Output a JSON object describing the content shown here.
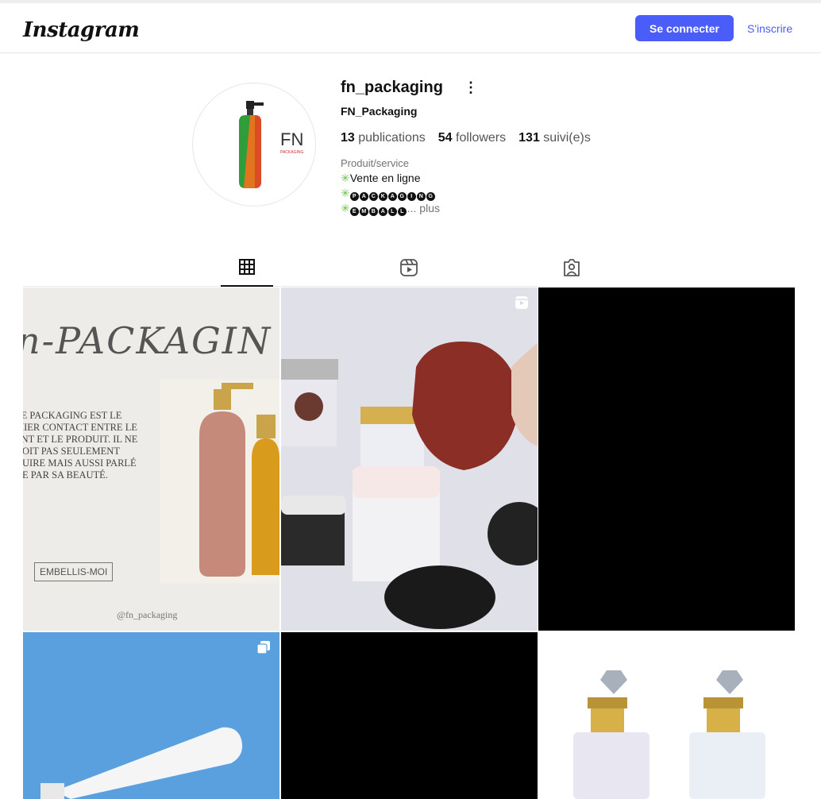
{
  "header": {
    "logo": "Instagram",
    "login_label": "Se connecter",
    "signup_label": "S'inscrire"
  },
  "profile": {
    "username": "fn_packaging",
    "more_icon": "⋮",
    "full_name": "FN_Packaging",
    "stats": [
      {
        "count": "13",
        "label": "publications"
      },
      {
        "count": "54",
        "label": "followers"
      },
      {
        "count": "131",
        "label": "suivi(e)s"
      }
    ],
    "category": "Produit/service",
    "bio_line1": "Vente en ligne",
    "bio_line2_letters": [
      "P",
      "A",
      "C",
      "K",
      "A",
      "G",
      "I",
      "N",
      "G"
    ],
    "bio_line3_letters": [
      "E",
      "M",
      "B",
      "A",
      "L",
      "L"
    ],
    "bio_more": "... plus",
    "avatar_text": "FN",
    "avatar_subtext": "PACKAGING"
  },
  "tabs": [
    {
      "name": "grid",
      "icon": "grid-icon"
    },
    {
      "name": "reels",
      "icon": "reels-icon"
    },
    {
      "name": "tagged",
      "icon": "tagged-user-icon"
    }
  ],
  "posts": {
    "p1_title": "n-PACKAGIN",
    "p1_text": "LE PACKAGING EST LE\nMIER CONTACT ENTRE LE\nENT ET LE PRODUIT. IL NE\nDOIT PAS SEULEMENT\nDUIRE MAIS AUSSI PARLÉ\nDE PAR SA BEAUTÉ.",
    "p1_tag": "EMBELLIS-MOI",
    "p1_handle": "@fn_packaging"
  },
  "colors": {
    "accent": "#4a5df9",
    "bio_star": "#6cc24a"
  }
}
